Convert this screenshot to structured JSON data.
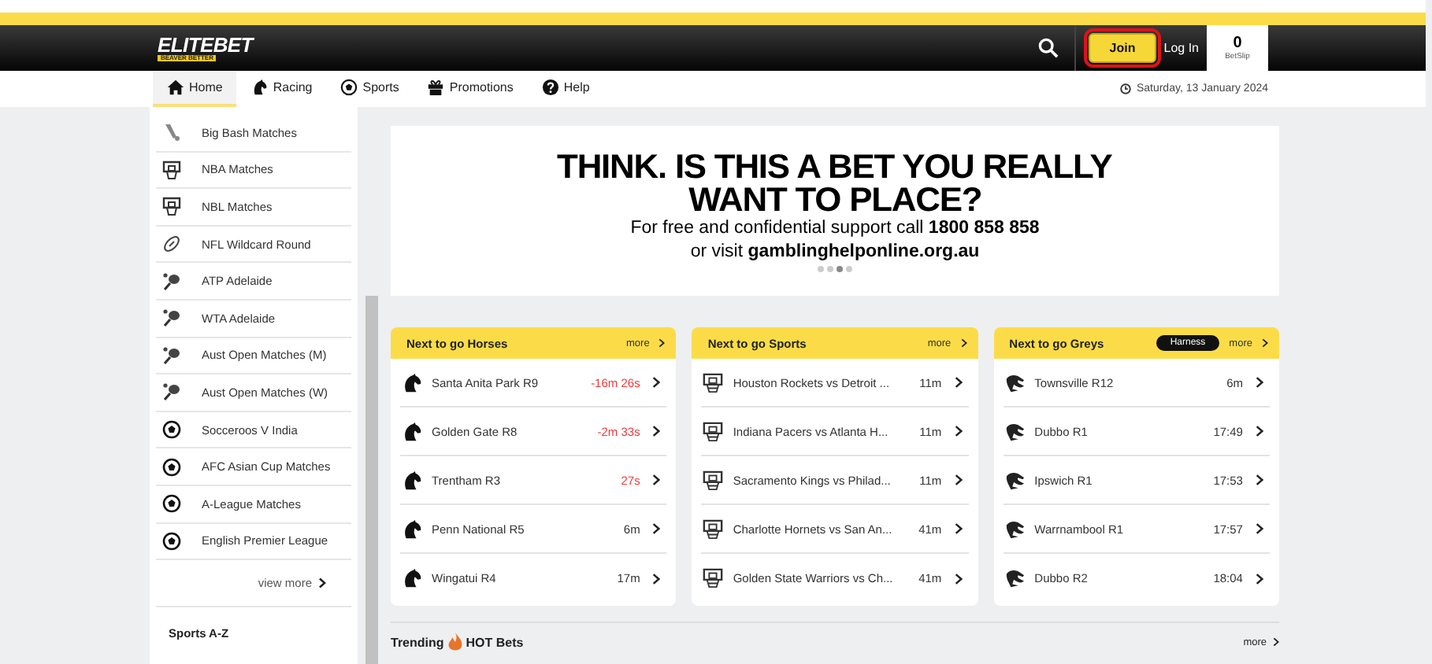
{
  "header": {
    "logo": "ELITEBET",
    "logo_tagline": "BEAVER BETTER",
    "join": {
      "label": "Join",
      "highlighted": true
    },
    "login": "Log In",
    "betslip": {
      "count": "0",
      "label": "BetSlip"
    }
  },
  "nav": {
    "tabs": [
      {
        "label": "Home",
        "kind": "home",
        "selected": true
      },
      {
        "label": "Racing",
        "kind": "horse",
        "selected": false
      },
      {
        "label": "Sports",
        "kind": "soccer",
        "selected": false
      },
      {
        "label": "Promotions",
        "kind": "gift",
        "selected": false
      },
      {
        "label": "Help",
        "kind": "help",
        "selected": false
      }
    ],
    "date": "Saturday, 13 January 2024"
  },
  "sidebar": {
    "items": [
      {
        "label": "Big Bash Matches",
        "kind": "cricket"
      },
      {
        "label": "NBA Matches",
        "kind": "basketball"
      },
      {
        "label": "NBL Matches",
        "kind": "basketball"
      },
      {
        "label": "NFL Wildcard Round",
        "kind": "football"
      },
      {
        "label": "ATP Adelaide",
        "kind": "tennis"
      },
      {
        "label": "WTA Adelaide",
        "kind": "tennis"
      },
      {
        "label": "Aust Open Matches (M)",
        "kind": "tennis"
      },
      {
        "label": "Aust Open Matches (W)",
        "kind": "tennis"
      },
      {
        "label": "Socceroos V India",
        "kind": "soccer"
      },
      {
        "label": "AFC Asian Cup Matches",
        "kind": "soccer"
      },
      {
        "label": "A-League Matches",
        "kind": "soccer"
      },
      {
        "label": "English Premier League",
        "kind": "soccer"
      }
    ],
    "view_more": "view more",
    "section": "Sports A-Z"
  },
  "banner": {
    "headline": [
      "THINK. IS THIS A BET YOU REALLY",
      "WANT TO PLACE?"
    ],
    "lines": [
      "For free and confidential support call **1800 858 858**",
      "or visit **gamblinghelponline.org.au**"
    ],
    "dots": [
      {
        "selected": false
      },
      {
        "selected": false
      },
      {
        "selected": true
      },
      {
        "selected": false
      }
    ]
  },
  "cards": [
    {
      "title": "Next to go Horses",
      "more": "more",
      "kind": "horse",
      "rows": [
        {
          "name": "Santa Anita Park R9",
          "time": "-16m 26s",
          "urgent": true
        },
        {
          "name": "Golden Gate R8",
          "time": "-2m 33s",
          "urgent": true
        },
        {
          "name": "Trentham R3",
          "time": "27s",
          "urgent": true
        },
        {
          "name": "Penn National R5",
          "time": "6m",
          "urgent": false
        },
        {
          "name": "Wingatui R4",
          "time": "17m",
          "urgent": false
        }
      ]
    },
    {
      "title": "Next to go Sports",
      "more": "more",
      "kind": "basketball",
      "rows": [
        {
          "name": "Houston Rockets vs Detroit ...",
          "time": "11m",
          "urgent": false
        },
        {
          "name": "Indiana Pacers vs Atlanta H...",
          "time": "11m",
          "urgent": false
        },
        {
          "name": "Sacramento Kings vs Philad...",
          "time": "11m",
          "urgent": false
        },
        {
          "name": "Charlotte Hornets vs San An...",
          "time": "41m",
          "urgent": false
        },
        {
          "name": "Golden State Warriors vs Ch...",
          "time": "41m",
          "urgent": false
        }
      ]
    },
    {
      "title": "Next to go Greys",
      "toggle": "Harness",
      "more": "more",
      "kind": "greyhound",
      "rows": [
        {
          "name": "Townsville R12",
          "time": "6m",
          "urgent": false
        },
        {
          "name": "Dubbo R1",
          "time": "17:49",
          "urgent": false
        },
        {
          "name": "Ipswich R1",
          "time": "17:53",
          "urgent": false
        },
        {
          "name": "Warrnambool R1",
          "time": "17:57",
          "urgent": false
        },
        {
          "name": "Dubbo R2",
          "time": "18:04",
          "urgent": false
        }
      ]
    }
  ],
  "trending": {
    "title": "Trending",
    "hot": "HOT Bets",
    "more": "more"
  }
}
